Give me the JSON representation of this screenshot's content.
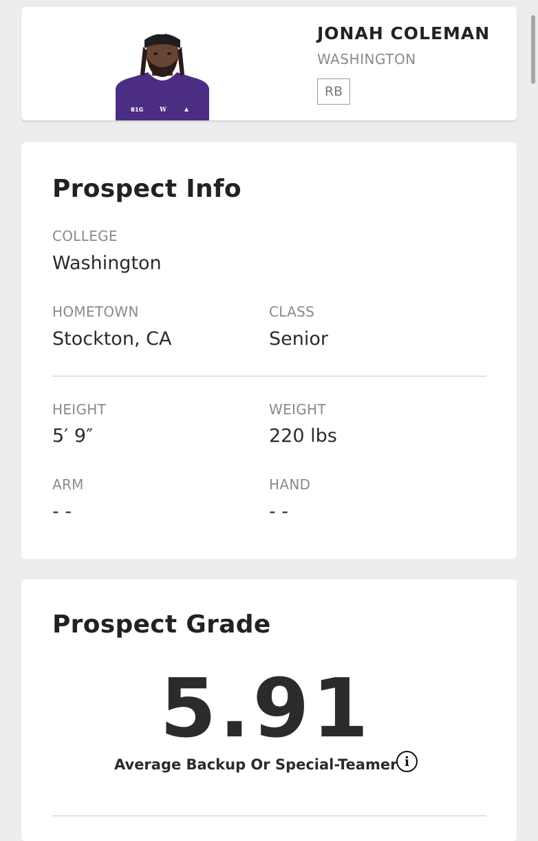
{
  "player": {
    "name": "JONAH COLEMAN",
    "team": "WASHINGTON",
    "position": "RB",
    "photo_icon": "player-headshot"
  },
  "prospect_info": {
    "title": "Prospect Info",
    "college_label": "COLLEGE",
    "college_value": "Washington",
    "hometown_label": "HOMETOWN",
    "hometown_value": "Stockton, CA",
    "class_label": "CLASS",
    "class_value": "Senior",
    "height_label": "HEIGHT",
    "height_value": "5′ 9″",
    "weight_label": "WEIGHT",
    "weight_value": "220 lbs",
    "arm_label": "ARM",
    "arm_value": "- -",
    "hand_label": "HAND",
    "hand_value": "- -"
  },
  "prospect_grade": {
    "title": "Prospect Grade",
    "grade": "5.91",
    "description": "Average Backup Or Special-Teamer",
    "info_icon": "info-circle-icon"
  },
  "colors": {
    "background": "#ededed",
    "card": "#ffffff",
    "jersey": "#4b2e83",
    "text": "#2b2b2b",
    "muted": "#8a8a8a"
  }
}
